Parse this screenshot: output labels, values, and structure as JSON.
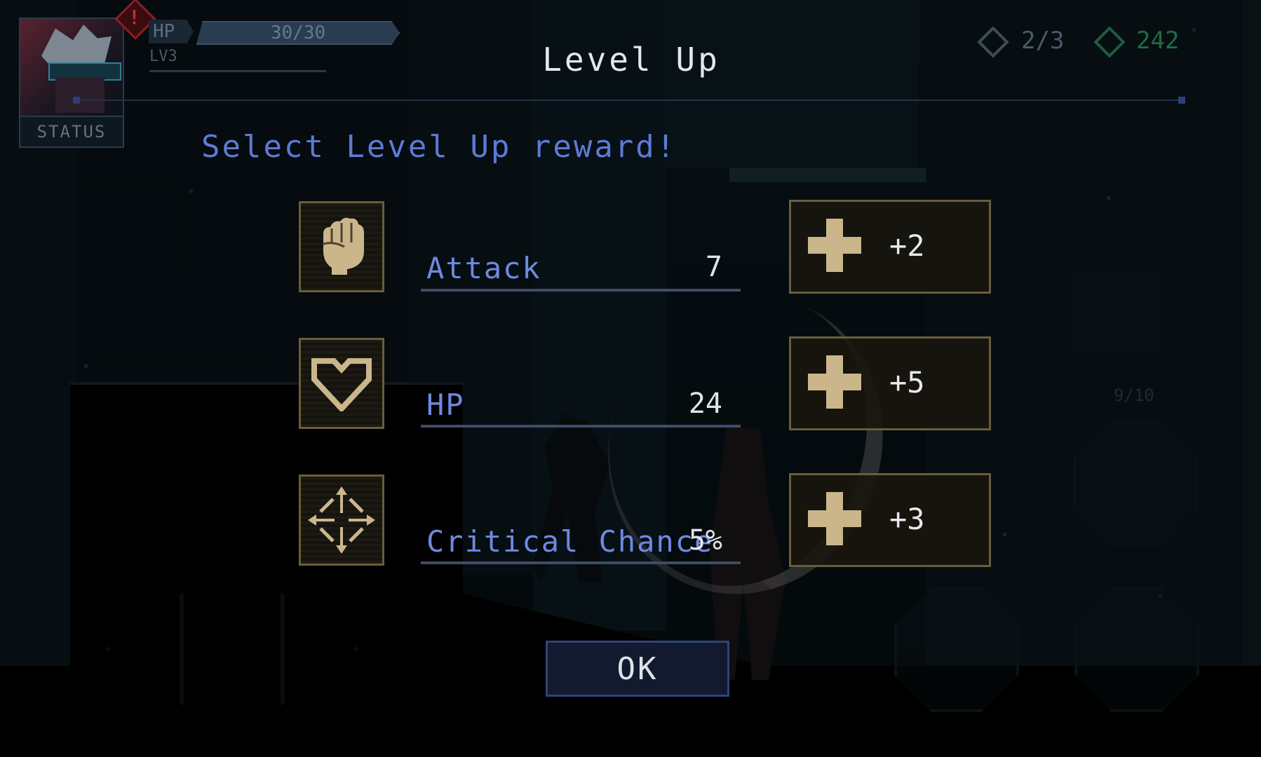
{
  "hud": {
    "status_label": "STATUS",
    "alert_symbol": "!",
    "hp_label": "HP",
    "hp_value": "30/30",
    "level": "LV3",
    "keys": "2/3",
    "credits": "242",
    "ammo": "9/10"
  },
  "dialog": {
    "title": "Level Up",
    "subtitle": "Select Level Up reward!",
    "ok_label": "OK",
    "stats": [
      {
        "name": "Attack",
        "value": "7",
        "bonus": "+2",
        "icon": "fist-icon"
      },
      {
        "name": "HP",
        "value": "24",
        "bonus": "+5",
        "icon": "heart-icon"
      },
      {
        "name": "Critical Chance",
        "value": "5%",
        "bonus": "+3",
        "icon": "crosshair-icon"
      }
    ]
  },
  "colors": {
    "accent_blue": "#6f89e2",
    "gold_frame": "#6a5d3c",
    "plus_gold": "#cbb68c"
  }
}
